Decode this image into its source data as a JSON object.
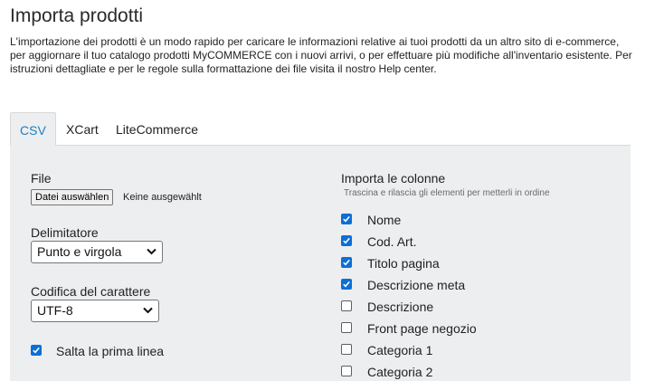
{
  "page": {
    "title": "Importa prodotti",
    "description": "L'importazione dei prodotti è un modo rapido per caricare le informazioni relative ai tuoi prodotti da un altro sito di e-commerce, per aggiornare il tuo catalogo prodotti MyCOMMERCE con i nuovi arrivi, o per effettuare più modifiche all'inventario esistente. Per istruzioni dettagliate e per le regole sulla formattazione dei file visita il nostro Help center."
  },
  "tabs": [
    {
      "label": "CSV",
      "active": true
    },
    {
      "label": "XCart",
      "active": false
    },
    {
      "label": "LiteCommerce",
      "active": false
    }
  ],
  "colors": {
    "accent": "#1f7fc4",
    "checkbox": "#0b6fd6",
    "panel": "#eceeef"
  },
  "form": {
    "file_label": "File",
    "file_button": "Datei auswählen",
    "file_status": "Keine ausgewählt",
    "delimiter_label": "Delimitatore",
    "delimiter_value": "Punto e virgola",
    "encoding_label": "Codifica del carattere",
    "encoding_value": "UTF-8",
    "skip_first_line_label": "Salta la prima linea",
    "skip_first_line_checked": true
  },
  "columns": {
    "title": "Importa le colonne",
    "hint": "Trascina e rilascia gli elementi per metterli in ordine",
    "items": [
      {
        "label": "Nome",
        "checked": true
      },
      {
        "label": "Cod. Art.",
        "checked": true
      },
      {
        "label": "Titolo pagina",
        "checked": true
      },
      {
        "label": "Descrizione meta",
        "checked": true
      },
      {
        "label": "Descrizione",
        "checked": false
      },
      {
        "label": "Front page negozio",
        "checked": false
      },
      {
        "label": "Categoria 1",
        "checked": false
      },
      {
        "label": "Categoria 2",
        "checked": false
      }
    ]
  },
  "icons": {
    "select_arrow": "chevron-down-icon",
    "check": "checkmark-icon"
  }
}
